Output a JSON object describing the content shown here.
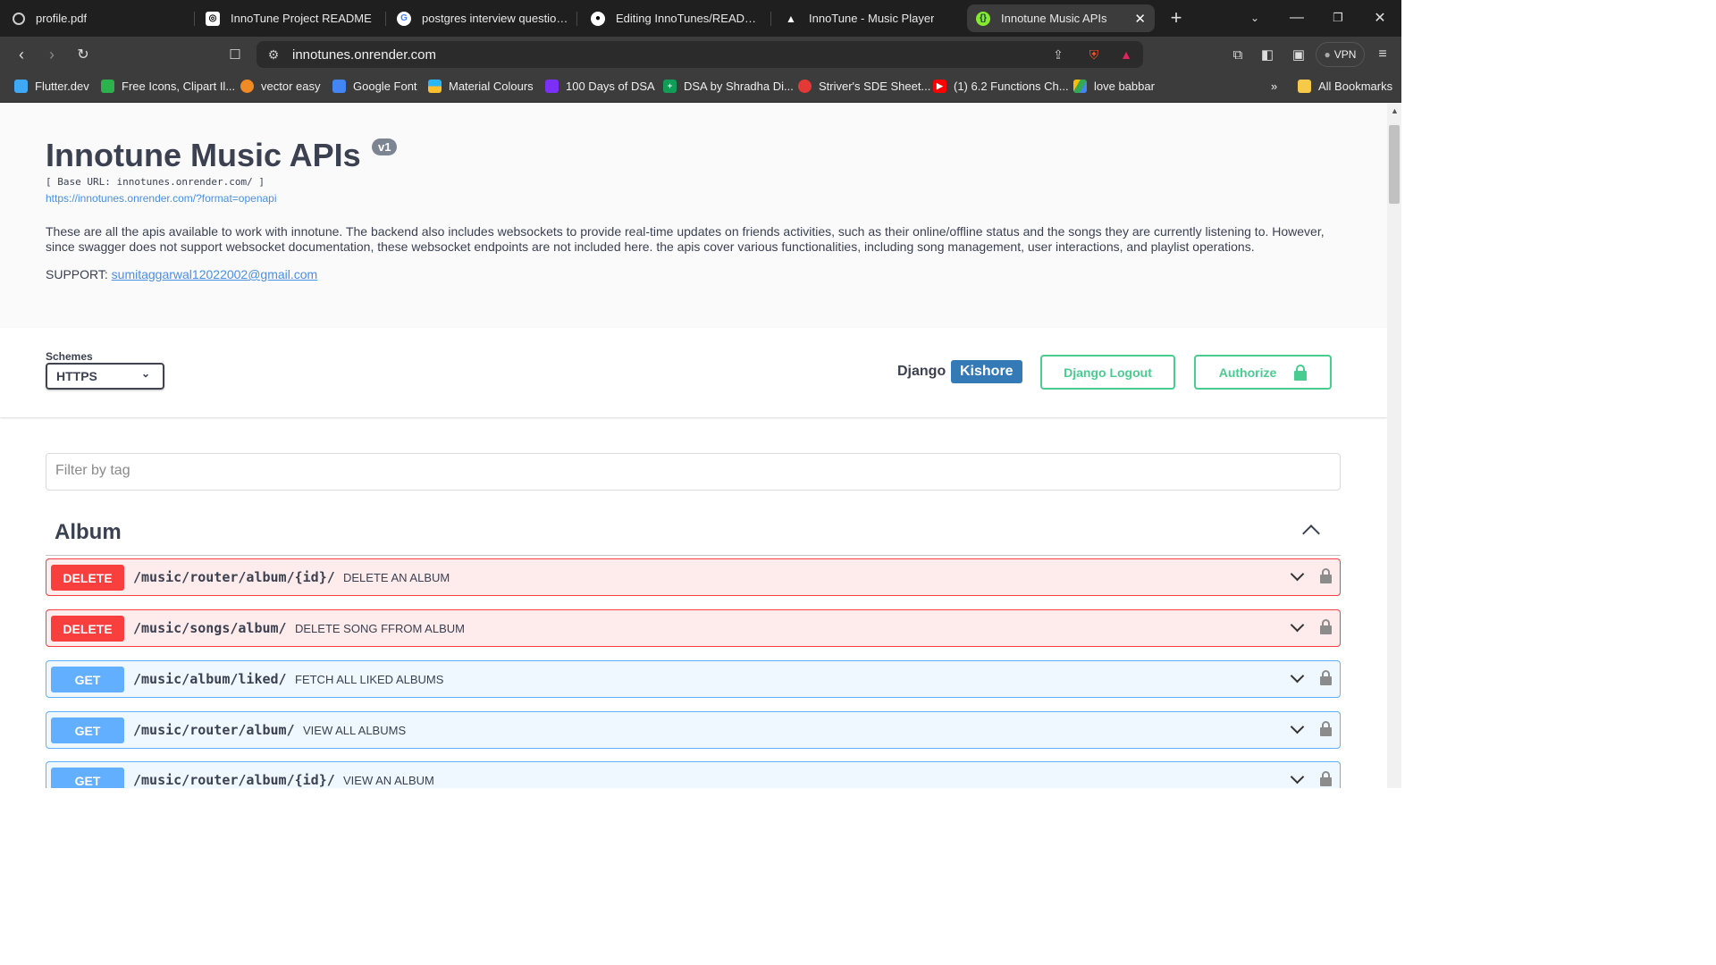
{
  "browser": {
    "tabs": [
      {
        "title": "profile.pdf",
        "icon": "globe-icon"
      },
      {
        "title": "InnoTune Project README",
        "icon": "openai-icon"
      },
      {
        "title": "postgres interview questions - (",
        "icon": "google-icon"
      },
      {
        "title": "Editing InnoTunes/README.md",
        "icon": "github-icon"
      },
      {
        "title": "InnoTune - Music Player",
        "icon": "triangle-icon"
      },
      {
        "title": "Innotune Music APIs",
        "icon": "swagger-icon",
        "active": true
      }
    ],
    "url": "innotunes.onrender.com",
    "vpn_label": "VPN",
    "bookmarks": [
      {
        "label": "Flutter.dev",
        "color": "#3fa9f5"
      },
      {
        "label": "Free Icons, Clipart Il...",
        "color": "#2bb24c"
      },
      {
        "label": "vector easy",
        "color": "#f08a24"
      },
      {
        "label": "Google Font",
        "color": "#4285f4"
      },
      {
        "label": "Material Colours",
        "color": "#fbbc05"
      },
      {
        "label": "100 Days of DSA",
        "color": "#7b2ff7"
      },
      {
        "label": "DSA by Shradha Di...",
        "color": "#0f9d58"
      },
      {
        "label": "Striver's SDE Sheet...",
        "color": "#e53935"
      },
      {
        "label": "(1) 6.2 Functions Ch...",
        "color": "#ff0000"
      },
      {
        "label": "love babbar",
        "color": "#34a853"
      }
    ],
    "more_bookmarks": "»",
    "all_bookmarks": "All Bookmarks"
  },
  "info": {
    "title": "Innotune Music APIs",
    "version": "v1",
    "base_url": "[ Base URL: innotunes.onrender.com/ ]",
    "spec_url": "https://innotunes.onrender.com/?format=openapi",
    "description": "These are all the apis available to work with innotune. The backend also includes websockets to provide real-time updates on friends activities, such as their online/offline status and the songs they are currently listening to. However, since swagger does not support websocket documentation, these websocket endpoints are not included here. the apis cover various functionalities, including song management, user interactions, and playlist operations.",
    "support_label": "SUPPORT:",
    "support_email": "sumitaggarwal12022002@gmail.com"
  },
  "schemes": {
    "label": "Schemes",
    "selected": "HTTPS"
  },
  "auth": {
    "django_label": "Django",
    "user": "Kishore",
    "logout_label": "Django Logout",
    "authorize_label": "Authorize"
  },
  "filter": {
    "placeholder": "Filter by tag"
  },
  "tag": {
    "name": "Album"
  },
  "operations": [
    {
      "method": "DELETE",
      "path": "/music/router/album/{id}/",
      "summary": "DELETE AN ALBUM"
    },
    {
      "method": "DELETE",
      "path": "/music/songs/album/",
      "summary": "DELETE SONG FFROM ALBUM"
    },
    {
      "method": "GET",
      "path": "/music/album/liked/",
      "summary": "FETCH ALL LIKED ALBUMS"
    },
    {
      "method": "GET",
      "path": "/music/router/album/",
      "summary": "VIEW ALL ALBUMS"
    },
    {
      "method": "GET",
      "path": "/music/router/album/{id}/",
      "summary": "VIEW AN ALBUM"
    }
  ],
  "colors": {
    "delete": "#f93e3e",
    "get": "#61affe",
    "authorize": "#49cc90",
    "user_badge": "#337ab7"
  }
}
